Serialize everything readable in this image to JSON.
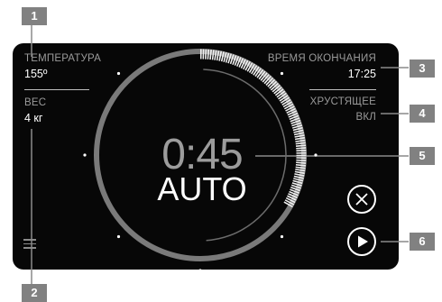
{
  "left": {
    "temperature_label": "ТЕМПЕРАТУРА",
    "temperature_value": "155º",
    "weight_label": "ВЕС",
    "weight_value": "4 кг"
  },
  "right": {
    "end_time_label": "ВРЕМЯ ОКОНЧАНИЯ",
    "end_time_value": "17:25",
    "crispy_label": "ХРУСТЯЩЕЕ",
    "crispy_value": "ВКЛ"
  },
  "center": {
    "time_remaining": "0:45",
    "mode": "AUTO",
    "progress": 0.25
  },
  "badges": {
    "b1": "1",
    "b2": "2",
    "b3": "3",
    "b4": "4",
    "b5": "5",
    "b6": "6"
  },
  "icons": {
    "menu": "menu-icon",
    "cancel": "close-circle-icon",
    "play": "play-circle-icon"
  },
  "colors": {
    "panel": "#070707",
    "badge": "#818181",
    "ring": "#7c7c7c",
    "progress": "#ffffff"
  }
}
